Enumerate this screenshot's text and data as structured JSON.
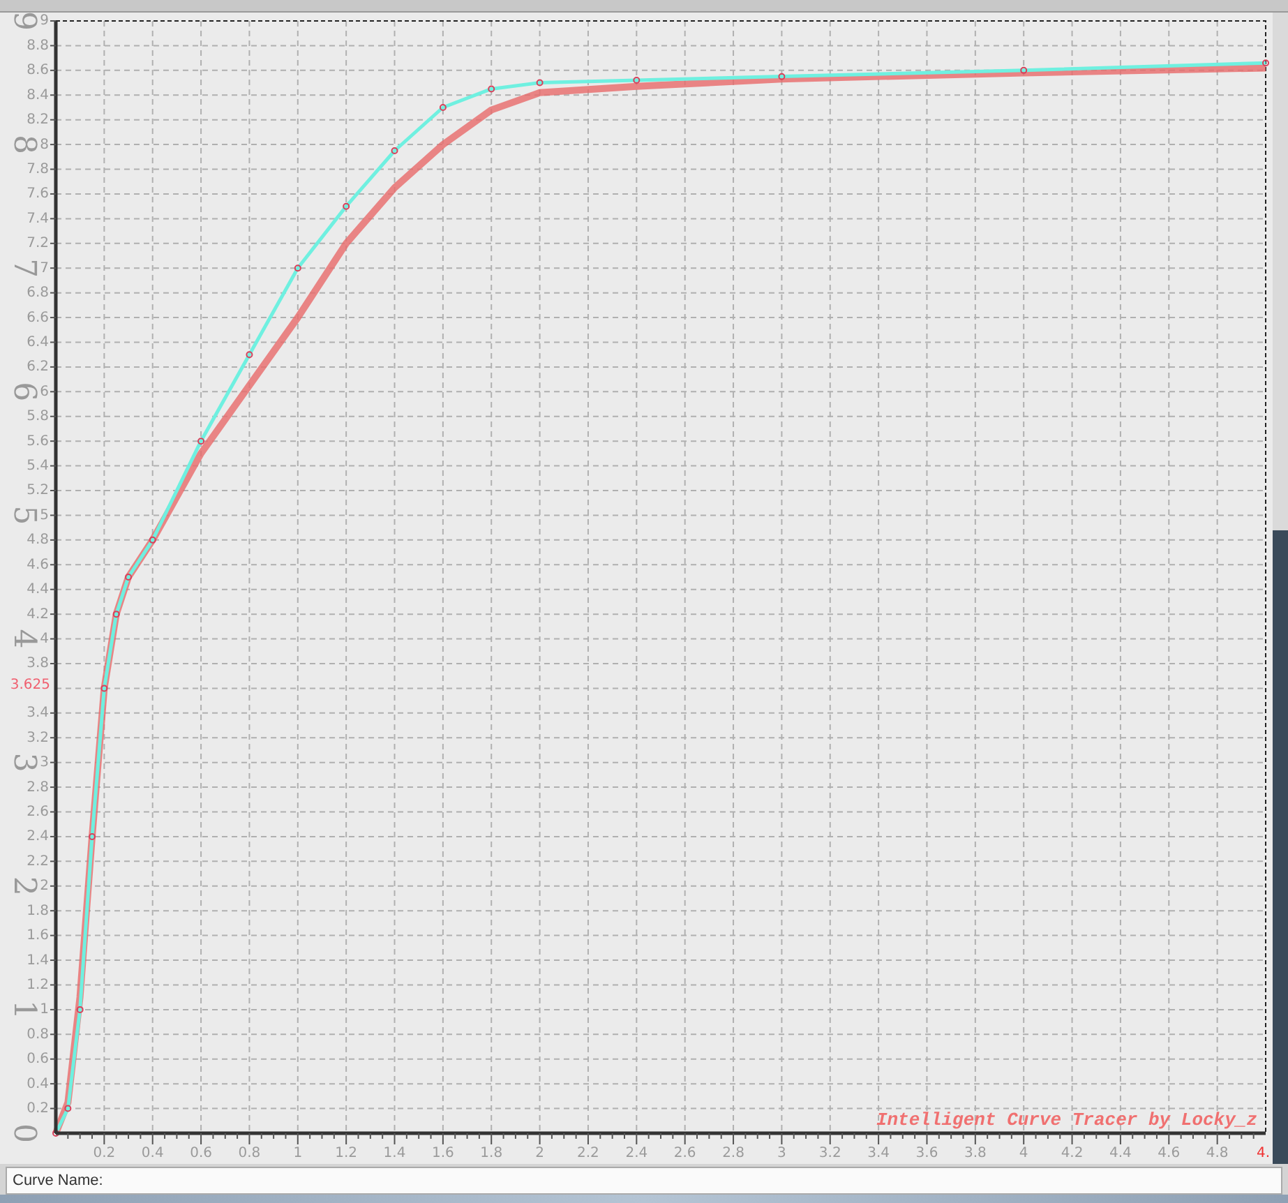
{
  "chart": {
    "chart_data": {
      "type": "line",
      "xlim": [
        0,
        5
      ],
      "ylim": [
        0,
        9
      ],
      "xticks": [
        {
          "value": 0.2,
          "label": "0.2"
        },
        {
          "value": 0.4,
          "label": "0.4"
        },
        {
          "value": 0.6,
          "label": "0.6"
        },
        {
          "value": 0.8,
          "label": "0.8"
        },
        {
          "value": 1,
          "label": "1"
        },
        {
          "value": 1.2,
          "label": "1.2"
        },
        {
          "value": 1.4,
          "label": "1.4"
        },
        {
          "value": 1.6,
          "label": "1.6"
        },
        {
          "value": 1.8,
          "label": "1.8"
        },
        {
          "value": 2,
          "label": "2"
        },
        {
          "value": 2.2,
          "label": "2.2"
        },
        {
          "value": 2.4,
          "label": "2.4"
        },
        {
          "value": 2.6,
          "label": "2.6"
        },
        {
          "value": 2.8,
          "label": "2.8"
        },
        {
          "value": 3,
          "label": "3"
        },
        {
          "value": 3.2,
          "label": "3.2"
        },
        {
          "value": 3.4,
          "label": "3.4"
        },
        {
          "value": 3.6,
          "label": "3.6"
        },
        {
          "value": 3.8,
          "label": "3.8"
        },
        {
          "value": 4,
          "label": "4"
        },
        {
          "value": 4.2,
          "label": "4.2"
        },
        {
          "value": 4.4,
          "label": "4.4"
        },
        {
          "value": 4.6,
          "label": "4.6"
        },
        {
          "value": 4.8,
          "label": "4.8"
        }
      ],
      "yticks": [
        {
          "value": 0.2,
          "label": "0.2"
        },
        {
          "value": 0.4,
          "label": "0.4"
        },
        {
          "value": 0.6,
          "label": "0.6"
        },
        {
          "value": 0.8,
          "label": "0.8"
        },
        {
          "value": 1,
          "label": "1"
        },
        {
          "value": 1.2,
          "label": "1.2"
        },
        {
          "value": 1.4,
          "label": "1.4"
        },
        {
          "value": 1.6,
          "label": "1.6"
        },
        {
          "value": 1.8,
          "label": "1.8"
        },
        {
          "value": 2,
          "label": "2"
        },
        {
          "value": 2.2,
          "label": "2.2"
        },
        {
          "value": 2.4,
          "label": "2.4"
        },
        {
          "value": 2.6,
          "label": "2.6"
        },
        {
          "value": 2.8,
          "label": "2.8"
        },
        {
          "value": 3,
          "label": "3"
        },
        {
          "value": 3.2,
          "label": "3.2"
        },
        {
          "value": 3.4,
          "label": "3.4"
        },
        {
          "value": 3.8,
          "label": "3.8"
        },
        {
          "value": 4,
          "label": "4"
        },
        {
          "value": 4.2,
          "label": "4.2"
        },
        {
          "value": 4.4,
          "label": "4.4"
        },
        {
          "value": 4.6,
          "label": "4.6"
        },
        {
          "value": 4.8,
          "label": "4.8"
        },
        {
          "value": 5,
          "label": "5"
        },
        {
          "value": 5.2,
          "label": "5.2"
        },
        {
          "value": 5.4,
          "label": "5.4"
        },
        {
          "value": 5.6,
          "label": "5.6"
        },
        {
          "value": 5.8,
          "label": "5.8"
        },
        {
          "value": 6,
          "label": "6"
        },
        {
          "value": 6.2,
          "label": "6.2"
        },
        {
          "value": 6.4,
          "label": "6.4"
        },
        {
          "value": 6.6,
          "label": "6.6"
        },
        {
          "value": 6.8,
          "label": "6.8"
        },
        {
          "value": 7,
          "label": "7"
        },
        {
          "value": 7.2,
          "label": "7.2"
        },
        {
          "value": 7.4,
          "label": "7.4"
        },
        {
          "value": 7.6,
          "label": "7.6"
        },
        {
          "value": 7.8,
          "label": "7.8"
        },
        {
          "value": 8,
          "label": "8"
        },
        {
          "value": 8.2,
          "label": "8.2"
        },
        {
          "value": 8.4,
          "label": "8.4"
        },
        {
          "value": 8.6,
          "label": "8.6"
        },
        {
          "value": 8.8,
          "label": "8.8"
        },
        {
          "value": 9,
          "label": "9"
        }
      ],
      "x": [
        0,
        0.05,
        0.1,
        0.15,
        0.2,
        0.25,
        0.3,
        0.4,
        0.6,
        0.8,
        1,
        1.2,
        1.4,
        1.6,
        1.8,
        2,
        2.4,
        3,
        4,
        5
      ],
      "series": [
        {
          "color": "#e86a6a",
          "values": [
            0,
            0.25,
            1.1,
            2.4,
            3.6,
            4.2,
            4.5,
            4.8,
            5.5,
            6.05,
            6.6,
            7.2,
            7.65,
            8.0,
            8.28,
            8.42,
            8.47,
            8.53,
            8.58,
            8.62
          ]
        },
        {
          "color": "#6ff0e0",
          "values": [
            0,
            0.2,
            1.0,
            2.4,
            3.6,
            4.2,
            4.5,
            4.8,
            5.6,
            6.3,
            7.0,
            7.5,
            7.95,
            8.3,
            8.45,
            8.5,
            8.52,
            8.55,
            8.6,
            8.66
          ]
        }
      ],
      "grid": true,
      "annotations": [
        "3.625",
        "4.",
        "Intelligent Curve Tracer by Locky_z"
      ]
    },
    "scan_y_digits": [
      "0",
      "1",
      "2",
      "3",
      "4",
      "5",
      "6",
      "7",
      "8",
      "9"
    ]
  },
  "status_bar": {
    "label": "Curve Name:"
  }
}
